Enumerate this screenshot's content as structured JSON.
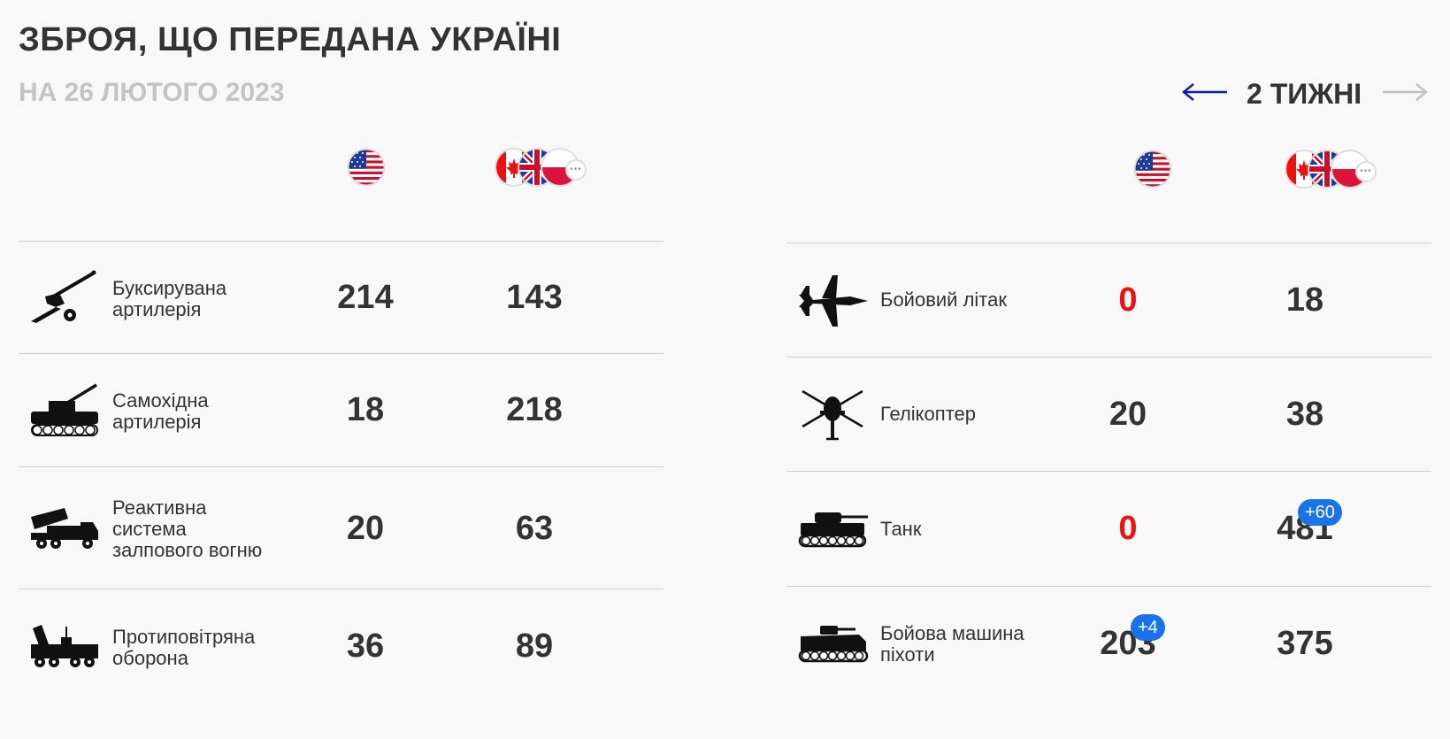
{
  "header": {
    "title": "ЗБРОЯ, ЩО ПЕРЕДАНА УКРАЇНІ",
    "date": "НА 26 ЛЮТОГО 2023",
    "period": "2 ТИЖНІ",
    "prev_icon": "arrow-left-icon",
    "next_icon": "arrow-right-icon"
  },
  "colors": {
    "zero_value": "#ee1111",
    "badge": "#1a73e8",
    "prev_arrow": "#1a1aa8",
    "next_arrow": "#c0c0c0"
  },
  "columns": {
    "us_flag": "us-flag-icon",
    "allies_flags": [
      "canada-flag-icon",
      "uk-flag-icon",
      "poland-flag-icon",
      "more-countries-icon"
    ]
  },
  "left": [
    {
      "icon": "towed-artillery-icon",
      "label": "Буксирувана артилерія",
      "us": "214",
      "others": "143"
    },
    {
      "icon": "self-propelled-artillery-icon",
      "label": "Самохідна артилерія",
      "us": "18",
      "others": "218"
    },
    {
      "icon": "rocket-launcher-icon",
      "label": "Реактивна система залпового вогню",
      "us": "20",
      "others": "63"
    },
    {
      "icon": "air-defense-icon",
      "label": "Протиповітряна оборона",
      "us": "36",
      "others": "89"
    }
  ],
  "right": [
    {
      "icon": "fighter-jet-icon",
      "label": "Бойовий літак",
      "us": "0",
      "others": "18"
    },
    {
      "icon": "helicopter-icon",
      "label": "Гелікоптер",
      "us": "20",
      "others": "38"
    },
    {
      "icon": "tank-icon",
      "label": "Танк",
      "us": "0",
      "others": "481",
      "others_badge": "+60"
    },
    {
      "icon": "ifv-icon",
      "label": "Бойова машина піхоти",
      "us": "203",
      "us_badge": "+4",
      "others": "375"
    }
  ]
}
